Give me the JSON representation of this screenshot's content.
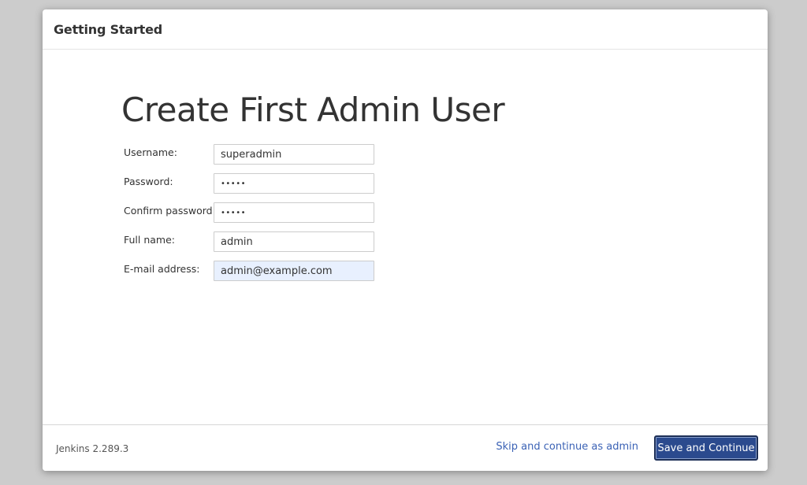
{
  "dialog": {
    "title": "Getting Started"
  },
  "main": {
    "heading": "Create First Admin User",
    "form": {
      "username": {
        "label": "Username:",
        "value": "superadmin"
      },
      "password": {
        "label": "Password:",
        "value": "•••••"
      },
      "confirm_password": {
        "label": "Confirm password:",
        "value": "•••••"
      },
      "full_name": {
        "label": "Full name:",
        "value": "admin"
      },
      "email": {
        "label": "E-mail address:",
        "value": "admin@example.com"
      }
    }
  },
  "footer": {
    "version": "Jenkins 2.289.3",
    "skip_label": "Skip and continue as admin",
    "save_label": "Save and Continue"
  },
  "colors": {
    "primary_button": "#2b4a8e",
    "link": "#3b62b5",
    "autofill_background": "#e8f0fe",
    "overlay_background": "#cccccc"
  }
}
